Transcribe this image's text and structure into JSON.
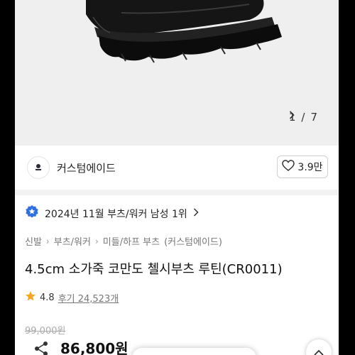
{
  "gallery": {
    "current_page": "1",
    "page_sep": "/",
    "total_pages": "7",
    "next_icon": "chevron-right-icon"
  },
  "seller": {
    "name": "커스텀에이드",
    "like_count": "3.9만",
    "like_icon": "heart-outline-icon"
  },
  "ranking": {
    "text": "2024년 11월 부츠/워커 남성 1위",
    "badge_icon": "award-badge-icon",
    "badge_color": "#2f6fe0"
  },
  "breadcrumb": {
    "items": [
      "신발",
      "부츠/워커",
      "미들/하프 부츠",
      "(커스텀에이드)"
    ]
  },
  "product": {
    "title": "4.5cm 소가죽 코만도 첼시부츠 루틴(CR0011)",
    "rating": "4.8",
    "review_label": "후기 24,523개",
    "star_color": "#f5a623",
    "original_price": "99,000원",
    "price": "86,800원"
  }
}
